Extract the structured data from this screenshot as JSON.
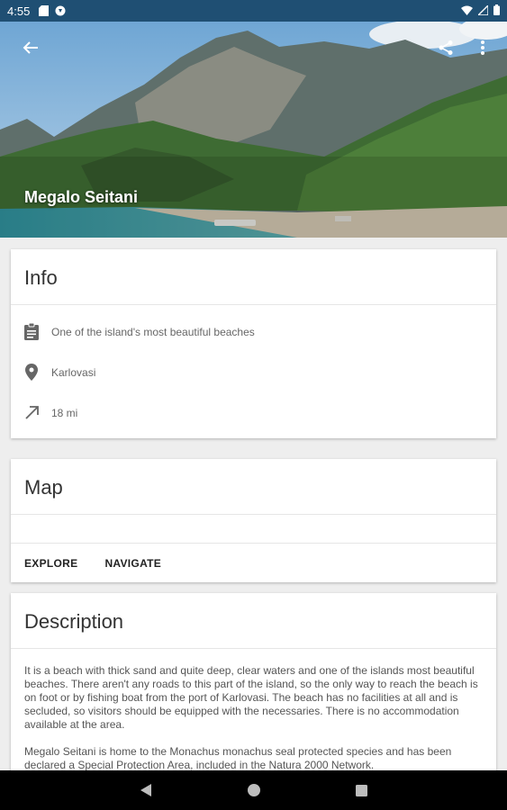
{
  "statusbar": {
    "time": "4:55"
  },
  "hero": {
    "title": "Megalo Seitani"
  },
  "info": {
    "heading": "Info",
    "rows": [
      {
        "icon": "clipboard-icon",
        "text": "One of the island's most beautiful beaches"
      },
      {
        "icon": "location-pin-icon",
        "text": "Karlovasi"
      },
      {
        "icon": "arrow-up-right-icon",
        "text": "18 mi"
      }
    ]
  },
  "map": {
    "heading": "Map",
    "explore_label": "EXPLORE",
    "navigate_label": "NAVIGATE"
  },
  "description": {
    "heading": "Description",
    "paragraphs": [
      "It is a beach with thick sand and quite deep, clear waters and one of the islands most beautiful beaches. There aren't any roads to this part of the island, so the only way to reach the beach is on foot or by fishing boat from the port of Karlovasi. The beach has no facilities at all and is secluded, so visitors should be equipped with the necessaries. There is no accommodation available at the area.",
      "Megalo Seitani is home to the Monachus monachus seal protected species and has been declared a Special Protection Area, included in the Natura 2000 Network."
    ]
  },
  "colors": {
    "statusbar": "#1f4f73",
    "navbar": "#000000",
    "accent_text": "#222222"
  }
}
